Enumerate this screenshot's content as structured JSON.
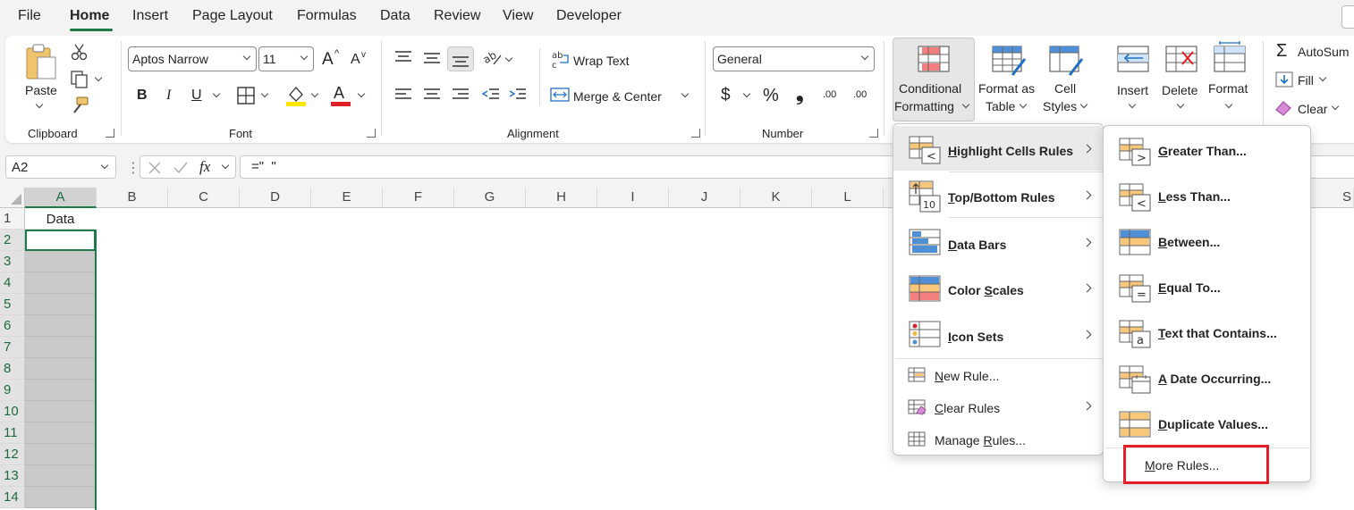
{
  "tabs": [
    "File",
    "Home",
    "Insert",
    "Page Layout",
    "Formulas",
    "Data",
    "Review",
    "View",
    "Developer"
  ],
  "ribbon": {
    "clipboard": {
      "paste_label": "Paste",
      "group_label": "Clipboard"
    },
    "font": {
      "font_name": "Aptos Narrow",
      "font_size": "11",
      "grow_icon": "A",
      "shrink_icon": "A",
      "bold": "B",
      "italic": "I",
      "underline": "U",
      "font_color_glyph": "A",
      "group_label": "Font"
    },
    "alignment": {
      "wrap_text": "Wrap Text",
      "merge_center": "Merge & Center",
      "group_label": "Alignment"
    },
    "number": {
      "format": "General",
      "currency": "$",
      "percent": "%",
      "comma": "❟",
      "inc_decimal": ".00",
      "dec_decimal": ".00",
      "group_label": "Number"
    },
    "styles": {
      "conditional_formatting": [
        "Conditional",
        "Formatting"
      ],
      "format_as_table": [
        "Format as",
        "Table"
      ],
      "cell_styles": [
        "Cell",
        "Styles"
      ]
    },
    "cells": {
      "insert": "Insert",
      "delete": "Delete",
      "format": "Format"
    },
    "editing": {
      "autosum": "AutoSum",
      "fill": "Fill",
      "clear": "Clear"
    }
  },
  "formula_bar": {
    "name_box": "A2",
    "formula": "=\"  \"",
    "fx": "fx"
  },
  "grid": {
    "columns": [
      "A",
      "B",
      "C",
      "D",
      "E",
      "F",
      "G",
      "H",
      "I",
      "J",
      "K",
      "L",
      "S"
    ],
    "rows": [
      "1",
      "2",
      "3",
      "4",
      "5",
      "6",
      "7",
      "8",
      "9",
      "10",
      "11",
      "12",
      "13",
      "14"
    ],
    "a1_value": "Data"
  },
  "cf_menu": {
    "items": [
      {
        "label": "Highlight Cells Rules",
        "underline": "H",
        "rest": "ighlight Cells Rules",
        "bold": true,
        "has_submenu": true
      },
      {
        "label": "Top/Bottom Rules",
        "underline": "T",
        "rest": "op/Bottom Rules",
        "bold": true,
        "has_submenu": true
      },
      {
        "label": "Data Bars",
        "underline": "D",
        "rest": "ata Bars",
        "bold": true,
        "has_submenu": true
      },
      {
        "label": "Color Scales",
        "pre": "Color ",
        "underline": "S",
        "rest": "cales",
        "bold": true,
        "has_submenu": true
      },
      {
        "label": "Icon Sets",
        "underline": "I",
        "rest": "con Sets",
        "bold": true,
        "has_submenu": true
      },
      {
        "label": "New Rule...",
        "underline": "N",
        "rest": "ew Rule...",
        "bold": false,
        "has_submenu": false
      },
      {
        "label": "Clear Rules",
        "underline": "C",
        "rest": "lear Rules",
        "bold": false,
        "has_submenu": true
      },
      {
        "label": "Manage Rules...",
        "pre": "Manage ",
        "underline": "R",
        "rest": "ules...",
        "bold": false,
        "has_submenu": false
      }
    ]
  },
  "submenu": {
    "items": [
      {
        "label": "Greater Than...",
        "underline": "G",
        "rest": "reater Than...",
        "glyph": ">"
      },
      {
        "label": "Less Than...",
        "underline": "L",
        "rest": "ess Than...",
        "glyph": "<"
      },
      {
        "label": "Between...",
        "underline": "B",
        "rest": "etween...",
        "glyph": ""
      },
      {
        "label": "Equal To...",
        "underline": "E",
        "rest": "qual To...",
        "glyph": "="
      },
      {
        "label": "Text that Contains...",
        "underline": "T",
        "rest": "ext that Contains...",
        "glyph": "a"
      },
      {
        "label": "A Date Occurring...",
        "underline": "A",
        "rest": " Date Occurring...",
        "glyph": ""
      },
      {
        "label": "Duplicate Values...",
        "underline": "D",
        "rest": "uplicate Values...",
        "glyph": ""
      }
    ],
    "more_rules": {
      "label": "More Rules...",
      "underline": "M",
      "rest": "ore Rules..."
    }
  },
  "colors": {
    "accent": "#1e7a47",
    "highlight_box": "#e01f26",
    "selection_gray": "#c9c9c9"
  }
}
